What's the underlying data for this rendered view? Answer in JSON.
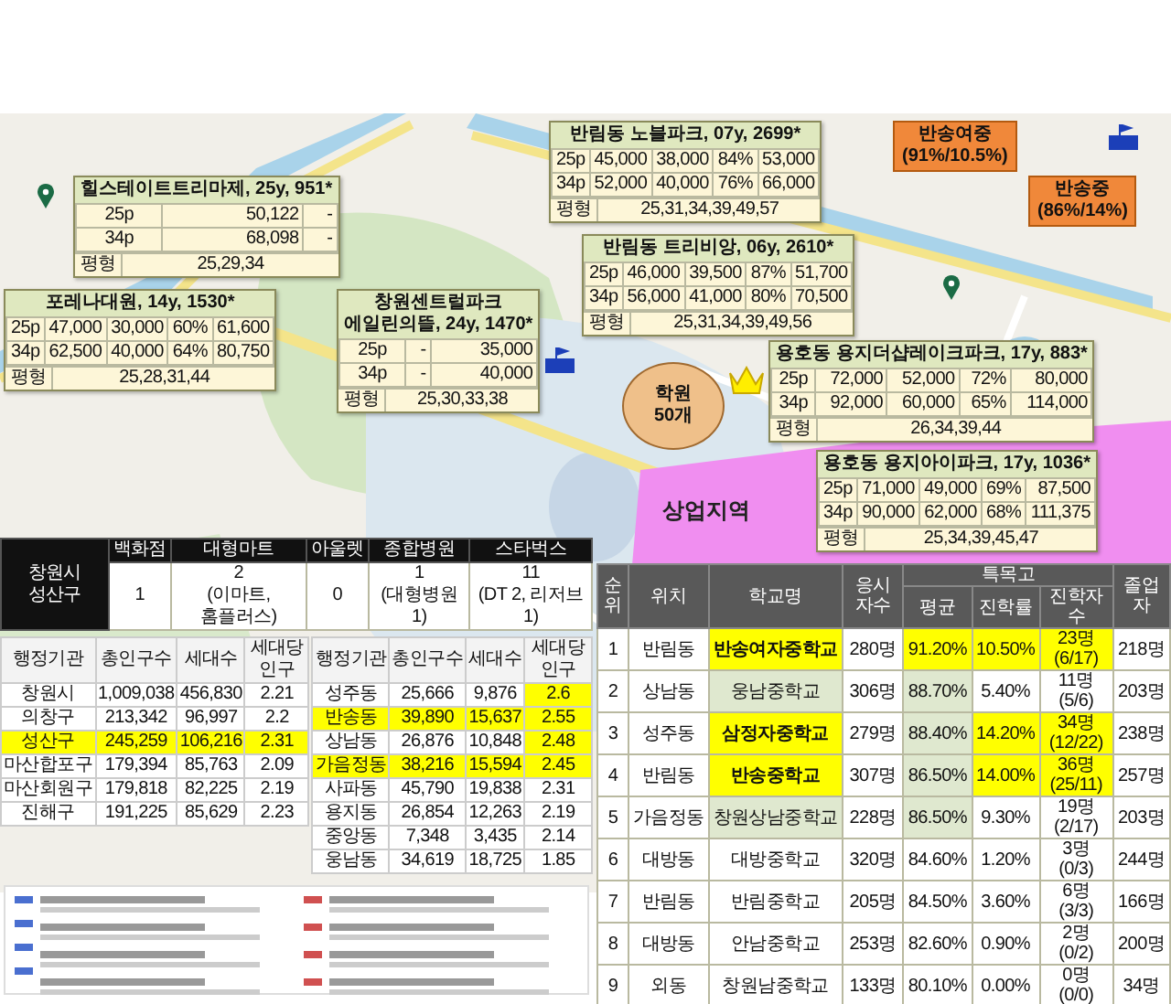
{
  "callouts": [
    {
      "title_lines": [
        "힐스테이트트리마제, 25y, 951*"
      ],
      "rows": [
        [
          "25p",
          "50,122",
          "-"
        ],
        [
          "34p",
          "68,098",
          "-"
        ]
      ],
      "sizes": {
        "label": "평형",
        "value": "25,29,34"
      }
    },
    {
      "title_lines": [
        "포레나대원, 14y, 1530*"
      ],
      "rows": [
        [
          "25p",
          "47,000",
          "30,000",
          "60%",
          "61,600"
        ],
        [
          "34p",
          "62,500",
          "40,000",
          "64%",
          "80,750"
        ]
      ],
      "sizes": {
        "label": "평형",
        "value": "25,28,31,44"
      }
    },
    {
      "title_lines": [
        "창원센트럴파크",
        "에일린의뜰, 24y, 1470*"
      ],
      "rows": [
        [
          "25p",
          "-",
          "35,000"
        ],
        [
          "34p",
          "-",
          "40,000"
        ]
      ],
      "sizes": {
        "label": "평형",
        "value": "25,30,33,38"
      }
    },
    {
      "title_lines": [
        "반림동 노블파크, 07y, 2699*"
      ],
      "rows": [
        [
          "25p",
          "45,000",
          "38,000",
          "84%",
          "53,000"
        ],
        [
          "34p",
          "52,000",
          "40,000",
          "76%",
          "66,000"
        ]
      ],
      "sizes": {
        "label": "평형",
        "value": "25,31,34,39,49,57"
      }
    },
    {
      "title_lines": [
        "반림동 트리비앙, 06y, 2610*"
      ],
      "rows": [
        [
          "25p",
          "46,000",
          "39,500",
          "87%",
          "51,700"
        ],
        [
          "34p",
          "56,000",
          "41,000",
          "80%",
          "70,500"
        ]
      ],
      "sizes": {
        "label": "평형",
        "value": "25,31,34,39,49,56"
      }
    },
    {
      "title_lines": [
        "용호동 용지더샵레이크파크, 17y, 883*"
      ],
      "rows": [
        [
          "25p",
          "72,000",
          "52,000",
          "72%",
          "80,000"
        ],
        [
          "34p",
          "92,000",
          "60,000",
          "65%",
          "114,000"
        ]
      ],
      "sizes": {
        "label": "평형",
        "value": "26,34,39,44"
      }
    },
    {
      "title_lines": [
        "용호동 용지아이파크, 17y, 1036*"
      ],
      "rows": [
        [
          "25p",
          "71,000",
          "49,000",
          "69%",
          "87,500"
        ],
        [
          "34p",
          "90,000",
          "62,000",
          "68%",
          "111,375"
        ]
      ],
      "sizes": {
        "label": "평형",
        "value": "25,34,39,45,47"
      }
    }
  ],
  "school_badges": [
    {
      "lines": [
        "반송여중",
        "(91%/10.5%)"
      ]
    },
    {
      "lines": [
        "반송중",
        "(86%/14%)"
      ]
    }
  ],
  "academy_area": {
    "lines": [
      "학원",
      "50개"
    ]
  },
  "zone_label": "상업지역",
  "region_summary": {
    "title": "창원시 성산구",
    "columns": [
      "백화점",
      "대형마트",
      "아울렛",
      "종합병원",
      "스타벅스"
    ],
    "values": [
      {
        "value": "1"
      },
      {
        "value": "2",
        "note": "(이마트,홈플러스)"
      },
      {
        "value": "0"
      },
      {
        "value": "1",
        "note": "(대형병원 1)"
      },
      {
        "value": "11",
        "note": "(DT 2, 리저브 1)"
      }
    ]
  },
  "population_tables": [
    {
      "columns": [
        "행정기관",
        "총인구수",
        "세대수",
        "세대당 인구"
      ],
      "rows": [
        {
          "cells": [
            "창원시",
            "1,009,038",
            "456,830",
            "2.21"
          ],
          "highlight": false,
          "ratio_highlight": false
        },
        {
          "cells": [
            "의창구",
            "213,342",
            "96,997",
            "2.2"
          ],
          "highlight": false,
          "ratio_highlight": false
        },
        {
          "cells": [
            "성산구",
            "245,259",
            "106,216",
            "2.31"
          ],
          "highlight": true,
          "ratio_highlight": false
        },
        {
          "cells": [
            "마산합포구",
            "179,394",
            "85,763",
            "2.09"
          ],
          "highlight": false,
          "ratio_highlight": false
        },
        {
          "cells": [
            "마산회원구",
            "179,818",
            "82,225",
            "2.19"
          ],
          "highlight": false,
          "ratio_highlight": false
        },
        {
          "cells": [
            "진해구",
            "191,225",
            "85,629",
            "2.23"
          ],
          "highlight": false,
          "ratio_highlight": false
        }
      ]
    },
    {
      "columns": [
        "행정기관",
        "총인구수",
        "세대수",
        "세대당 인구"
      ],
      "rows": [
        {
          "cells": [
            "성주동",
            "25,666",
            "9,876",
            "2.6"
          ],
          "highlight": false,
          "ratio_highlight": true
        },
        {
          "cells": [
            "반송동",
            "39,890",
            "15,637",
            "2.55"
          ],
          "highlight": true,
          "ratio_highlight": true
        },
        {
          "cells": [
            "상남동",
            "26,876",
            "10,848",
            "2.48"
          ],
          "highlight": false,
          "ratio_highlight": true
        },
        {
          "cells": [
            "가음정동",
            "38,216",
            "15,594",
            "2.45"
          ],
          "highlight": true,
          "ratio_highlight": true
        },
        {
          "cells": [
            "사파동",
            "45,790",
            "19,838",
            "2.31"
          ],
          "highlight": false,
          "ratio_highlight": false
        },
        {
          "cells": [
            "용지동",
            "26,854",
            "12,263",
            "2.19"
          ],
          "highlight": false,
          "ratio_highlight": false
        },
        {
          "cells": [
            "중앙동",
            "7,348",
            "3,435",
            "2.14"
          ],
          "highlight": false,
          "ratio_highlight": false
        },
        {
          "cells": [
            "웅남동",
            "34,619",
            "18,725",
            "1.85"
          ],
          "highlight": false,
          "ratio_highlight": false
        }
      ]
    }
  ],
  "school_table": {
    "columns": [
      "순위",
      "위치",
      "학교명",
      "응시자수"
    ],
    "group": {
      "label": "특목고",
      "columns": [
        "평균",
        "진학률",
        "진학자수"
      ]
    },
    "last_column": "졸업자",
    "rows": [
      {
        "cells": [
          "1",
          "반림동",
          "반송여자중학교",
          "280명",
          "91.20%",
          "10.50%",
          "23명 (6/17)",
          "218명"
        ],
        "name_highlight": true,
        "name_shaded": false,
        "avg_highlight": true,
        "avg_shaded": false,
        "rate_highlight": true
      },
      {
        "cells": [
          "2",
          "상남동",
          "웅남중학교",
          "306명",
          "88.70%",
          "5.40%",
          "11명 (5/6)",
          "203명"
        ],
        "name_highlight": false,
        "name_shaded": true,
        "avg_highlight": false,
        "avg_shaded": true,
        "rate_highlight": false
      },
      {
        "cells": [
          "3",
          "성주동",
          "삼정자중학교",
          "279명",
          "88.40%",
          "14.20%",
          "34명 (12/22)",
          "238명"
        ],
        "name_highlight": true,
        "name_shaded": false,
        "avg_highlight": false,
        "avg_shaded": true,
        "rate_highlight": true
      },
      {
        "cells": [
          "4",
          "반림동",
          "반송중학교",
          "307명",
          "86.50%",
          "14.00%",
          "36명 (25/11)",
          "257명"
        ],
        "name_highlight": true,
        "name_shaded": false,
        "avg_highlight": false,
        "avg_shaded": true,
        "rate_highlight": true
      },
      {
        "cells": [
          "5",
          "가음정동",
          "창원상남중학교",
          "228명",
          "86.50%",
          "9.30%",
          "19명 (2/17)",
          "203명"
        ],
        "name_highlight": false,
        "name_shaded": true,
        "avg_highlight": false,
        "avg_shaded": true,
        "rate_highlight": false
      },
      {
        "cells": [
          "6",
          "대방동",
          "대방중학교",
          "320명",
          "84.60%",
          "1.20%",
          "3명 (0/3)",
          "244명"
        ],
        "name_highlight": false,
        "name_shaded": false,
        "avg_highlight": false,
        "avg_shaded": false,
        "rate_highlight": false
      },
      {
        "cells": [
          "7",
          "반림동",
          "반림중학교",
          "205명",
          "84.50%",
          "3.60%",
          "6명 (3/3)",
          "166명"
        ],
        "name_highlight": false,
        "name_shaded": false,
        "avg_highlight": false,
        "avg_shaded": false,
        "rate_highlight": false
      },
      {
        "cells": [
          "8",
          "대방동",
          "안남중학교",
          "253명",
          "82.60%",
          "0.90%",
          "2명 (0/2)",
          "200명"
        ],
        "name_highlight": false,
        "name_shaded": false,
        "avg_highlight": false,
        "avg_shaded": false,
        "rate_highlight": false
      },
      {
        "cells": [
          "9",
          "외동",
          "창원남중학교",
          "133명",
          "80.10%",
          "0.00%",
          "0명 (0/0)",
          "34명"
        ],
        "name_highlight": false,
        "name_shaded": false,
        "avg_highlight": false,
        "avg_shaded": false,
        "rate_highlight": false
      }
    ]
  }
}
